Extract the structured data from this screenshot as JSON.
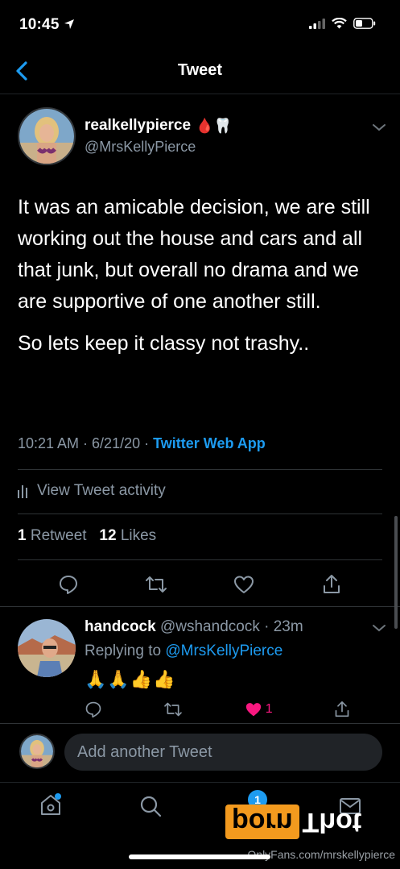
{
  "status_bar": {
    "time": "10:45"
  },
  "nav": {
    "title": "Tweet"
  },
  "tweet": {
    "display_name": "realkellypierce",
    "name_emojis": "🩸🦷",
    "handle": "@MrsKellyPierce",
    "paragraphs": [
      "It was an amicable decision, we are still working out the house and cars and all that junk, but overall no drama and we are supportive of one another still.",
      "So lets keep it classy not trashy.."
    ],
    "timestamp": "10:21 AM · 6/21/20 · ",
    "source": "Twitter Web App",
    "activity_label": "View Tweet activity",
    "retweet_count": "1",
    "retweet_label": " Retweet",
    "like_count": "12",
    "like_label": " Likes"
  },
  "reply": {
    "display_name": "handcock",
    "handle_time": " @wshandcock · 23m",
    "replying_prefix": "Replying to ",
    "replying_handle": "@MrsKellyPierce",
    "text": "🙏🙏👍👍",
    "like_count": "1"
  },
  "compose": {
    "placeholder": "Add another Tweet"
  },
  "tabbar": {
    "notification_badge": "1"
  },
  "watermark": {
    "brand_left": "porn",
    "brand_right": "Thot",
    "url": "OnlyFans.com/mrskellypierce"
  },
  "colors": {
    "accent": "#1d9bf0",
    "muted": "#8b98a5",
    "like": "#f91880",
    "background": "#000000"
  }
}
